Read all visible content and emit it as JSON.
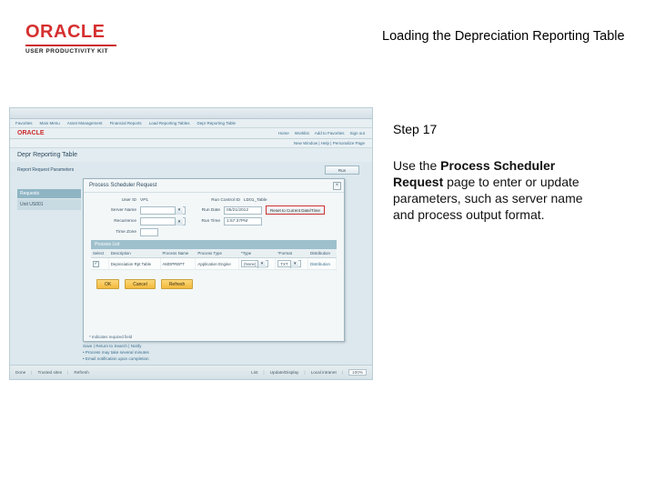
{
  "branding": {
    "oracle": "ORACLE",
    "upk": "USER PRODUCTIVITY KIT"
  },
  "title": "Loading the Depreciation Reporting Table",
  "step_label": "Step 17",
  "instruction": {
    "pre": "Use the ",
    "bold": "Process Scheduler Request",
    "post": " page to enter or update parameters, such as server name and process output format."
  },
  "screenshot": {
    "breadcrumb": [
      "Favorites",
      "Main Menu",
      "Asset Management",
      "Financial Reports",
      "Load Reporting Tables",
      "Depr Reporting Table"
    ],
    "oracle_mini": "ORACLE",
    "app_links": [
      "Home",
      "Worklist",
      "Add to Favorites",
      "Sign out"
    ],
    "util": "New Window | Help | Personalize Page",
    "page_header": "Depr Reporting Table",
    "label_report": "Report Request Parameters",
    "audit_btn": "Run",
    "sidebar": {
      "header": "Requests",
      "row": "Unit US001"
    },
    "dialog": {
      "title": "Process Scheduler Request",
      "close": "×",
      "fields": {
        "user_id_label": "User ID",
        "user_id_value": "VP1",
        "run_ctrl_label": "Run Control ID",
        "run_ctrl_value": "LD01_Table",
        "server_label": "Server Name",
        "server_value": "",
        "run_date_label": "Run Date",
        "run_date_value": "05/21/2012",
        "reset_btn": "Reset to Current Date/Time",
        "recurrence_label": "Recurrence",
        "recurrence_value": "",
        "run_time_label": "Run Time",
        "run_time_value": "1:57:37PM",
        "tz_label": "Time Zone",
        "tz_value": ""
      },
      "process_list": {
        "header": "Process List",
        "columns": [
          "Select",
          "Description",
          "Process Name",
          "Process Type",
          "*Type",
          "*Format",
          "Distribution"
        ],
        "row": {
          "checked": "✓",
          "description": "Depreciation Rpt Table",
          "process_name": "AMDPREPT",
          "process_type": "Application Engine",
          "type": "(None)",
          "format": "TXT",
          "distribution": "Distribution"
        }
      },
      "actions": {
        "ok": "OK",
        "cancel": "Cancel",
        "refresh": "Refresh"
      },
      "footnote": "* Indicates required field"
    },
    "after_dialog": {
      "line1": "Save  |  Return to Search  |  Notify",
      "line2": "• Process may take several minutes",
      "line3": "• Email notification upon completion"
    },
    "footer": {
      "left": [
        "Done",
        "Trusted sites",
        "Refresh"
      ],
      "right_items": [
        "List",
        "Update/Display"
      ],
      "internet": "Local intranet",
      "zoom": "100%"
    }
  }
}
